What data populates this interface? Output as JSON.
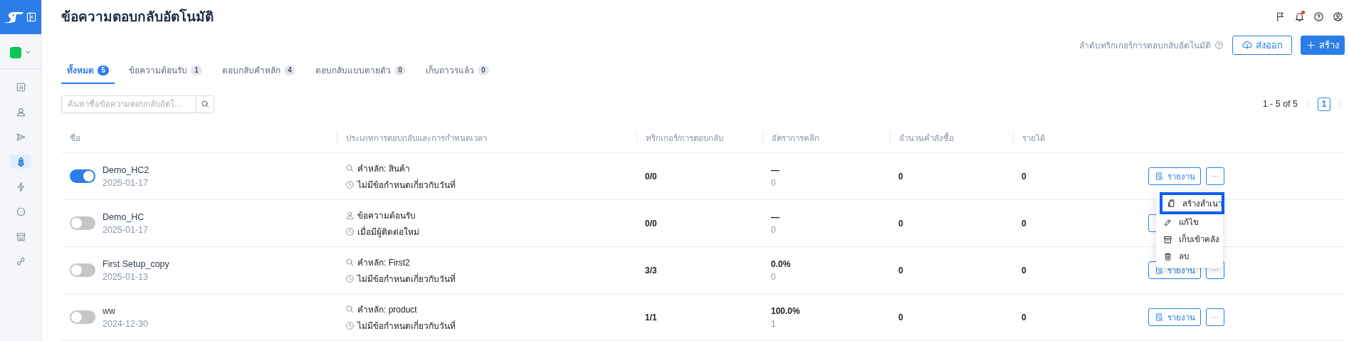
{
  "sidebar": {
    "items": [
      {
        "kind": "chart",
        "selected": false
      },
      {
        "kind": "user",
        "selected": false
      },
      {
        "kind": "send",
        "selected": false
      },
      {
        "kind": "rocket",
        "selected": true
      },
      {
        "kind": "bolt",
        "selected": false
      },
      {
        "kind": "chat",
        "selected": false
      },
      {
        "kind": "store",
        "selected": false
      },
      {
        "kind": "link",
        "selected": false
      }
    ]
  },
  "header": {
    "title": "ข้อความตอบกลับอัตโนมัติ",
    "has_unread_notifications": true
  },
  "toolbar": {
    "trigger_order_link": "ลำดับทริกเกอร์การตอบกลับอัตโนมัติ",
    "export_button": "ส่งออก",
    "create_button": "สร้าง"
  },
  "tabs": [
    {
      "label": "ทั้งหมด",
      "count": "5",
      "selected": true
    },
    {
      "label": "ข้อความต้อนรับ",
      "count": "1",
      "selected": false
    },
    {
      "label": "ตอบกลับคำหลัก",
      "count": "4",
      "selected": false
    },
    {
      "label": "ตอบกลับแบบตายตัว",
      "count": "0",
      "selected": false
    },
    {
      "label": "เก็บถาวรแล้ว",
      "count": "0",
      "selected": false
    }
  ],
  "search": {
    "placeholder": "ค้นหาชื่อข้อความตอบกลับอัตโ..."
  },
  "pagination": {
    "range": "1 - 5 of 5",
    "pages": [
      {
        "label": "1",
        "selected": true
      }
    ]
  },
  "table": {
    "columns": [
      "ชื่อ",
      "ประเภทการตอบกลับและการกำหนดเวลา",
      "ทริกเกอร์/การตอบกลับ",
      "อัตราการคลิก",
      "จำนวนคำสั่งซื้อ",
      "รายได้"
    ],
    "rows": [
      {
        "enabled": true,
        "name": "Demo_HC2",
        "date": "2025-01-17",
        "reply_type": {
          "kind": "keyword",
          "text": "คำหลัก: สินค้า"
        },
        "schedule": "ไม่มีข้อกำหนดเกี่ยวกับวันที่",
        "triggers": "0/0",
        "click_rate": "—",
        "clicks": "0",
        "orders": "0",
        "revenue": "0",
        "report_button": "รายงาน",
        "more_button": "···"
      },
      {
        "enabled": false,
        "name": "Demo_HC",
        "date": "2025-01-17",
        "reply_type": {
          "kind": "welcome",
          "text": "ข้อความต้อนรับ"
        },
        "schedule": "เมื่อมีผู้ติดต่อใหม่",
        "triggers": "0/0",
        "click_rate": "—",
        "clicks": "0",
        "orders": "0",
        "revenue": "0"
      },
      {
        "enabled": false,
        "name": "First Setup_copy",
        "date": "2025-01-13",
        "reply_type": {
          "kind": "keyword",
          "text": "คำหลัก: First2"
        },
        "schedule": "ไม่มีข้อกำหนดเกี่ยวกับวันที่",
        "triggers": "3/3",
        "click_rate": "0.0%",
        "clicks": "0",
        "orders": "0",
        "revenue": "0",
        "report_button": "รายงาน",
        "more_button": "···"
      },
      {
        "enabled": false,
        "name": "ww",
        "date": "2024-12-30",
        "reply_type": {
          "kind": "keyword",
          "text": "คำหลัก: product"
        },
        "schedule": "ไม่มีข้อกำหนดเกี่ยวกับวันที่",
        "triggers": "1/1",
        "click_rate": "100.0%",
        "clicks": "1",
        "orders": "0",
        "revenue": "0",
        "report_button": "รายงาน",
        "more_button": "···"
      }
    ]
  },
  "row_menu": {
    "items": [
      {
        "kind": "copy",
        "label": "สร้างสำเนา",
        "focused": true
      },
      {
        "kind": "edit",
        "label": "แก้ไข",
        "focused": false
      },
      {
        "kind": "archive",
        "label": "เก็บเข้าคลัง",
        "focused": false
      },
      {
        "kind": "delete",
        "label": "ลบ",
        "focused": false
      }
    ]
  }
}
